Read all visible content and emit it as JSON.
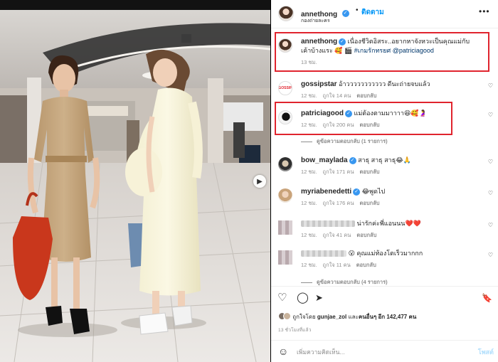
{
  "post": {
    "username": "annethong",
    "verified_mark": "✓",
    "dot": "•",
    "follow_label": "ติดตาม",
    "subtitle": "กองถ่ายละคร",
    "more_label": "•••"
  },
  "caption": {
    "username": "annethong",
    "text": " เนื่องชีวิตอิสระ..อยากหาจังหวะเป็นคุณแม่กับเค้าบ้างแระ 🥰 🎬 ",
    "hashtag": "#เกมรักทรยศ",
    "mention": "@patriciagood",
    "time": "13 ชม."
  },
  "comments": [
    {
      "username": "gossipstar",
      "avatar_label": "GOSSIP",
      "text": " อ้าววววววววววว ดีนะถ่ายจบแล้ว",
      "time": "12 ชม.",
      "likes": "ถูกใจ 14 คน",
      "reply": "ตอบกลับ"
    },
    {
      "username": "patriciagood",
      "text": " แม่ต้องตามมาาาา😆🥰🤰",
      "time": "12 ชม.",
      "likes": "ถูกใจ 200 คน",
      "reply": "ตอบกลับ",
      "view_replies": "ดูข้อความตอบกลับ (1 รายการ)"
    },
    {
      "username": "bow_maylada",
      "text": " สาธุ สาธุ สาธุ😂🙏",
      "time": "12 ชม.",
      "likes": "ถูกใจ 171 คน",
      "reply": "ตอบกลับ"
    },
    {
      "username": "myriabenedetti",
      "text": " 😂พูดไป",
      "time": "12 ชม.",
      "likes": "ถูกใจ 176 คน",
      "reply": "ตอบกลับ"
    },
    {
      "text": " น่ารักค่ะพี่แอนนน❤️❤️",
      "time": "12 ชม.",
      "likes": "ถูกใจ 41 คน",
      "reply": "ตอบกลับ"
    },
    {
      "text": " 😮 คุณแม่ท้องโตเร็วมากกก",
      "time": "12 ชม.",
      "likes": "ถูกใจ 11 คน",
      "reply": "ตอบกลับ",
      "view_replies": "ดูข้อความตอบกลับ (4 รายการ)"
    }
  ],
  "icons": {
    "heart": "♡",
    "comment": "◯",
    "share": "➤",
    "save": "🔖",
    "emoji": "☺",
    "carousel_next": "▶"
  },
  "likes": {
    "prefix": "ถูกใจโดย ",
    "first_user": "gunjae_zol",
    "middle": " และ",
    "others": "คนอื่นๆ อีก 142,477 คน"
  },
  "timestamp": "13 ชั่วโมงที่แล้ว",
  "add_comment": {
    "placeholder": "เพิ่มความคิดเห็น...",
    "post_label": "โพสต์"
  },
  "colors": {
    "link_blue": "#0095f6",
    "highlight_red": "#e0242e",
    "post_button_disabled": "#b2dffc"
  }
}
